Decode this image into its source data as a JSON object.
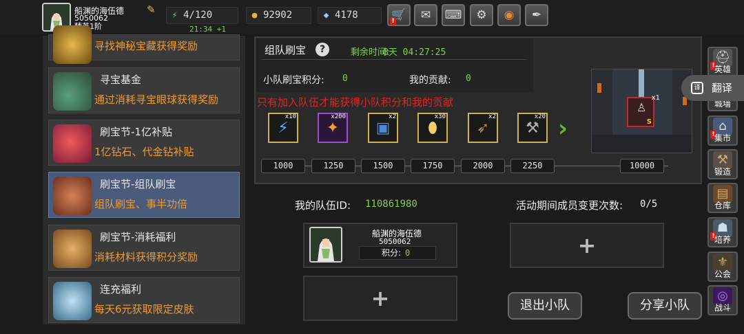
{
  "player": {
    "name": "船渊的海伍德",
    "id": "5050062",
    "rank": "精英1阶"
  },
  "resources": {
    "energy": "4/120",
    "gold": "92902",
    "gems": "4178",
    "timer": "21:34 +1"
  },
  "left_menu": [
    {
      "title": "",
      "desc": "寻找神秘宝藏获得奖励"
    },
    {
      "title": "寻宝基金",
      "desc": "通过消耗寻宝眼球获得奖励"
    },
    {
      "title": "刷宝节-1亿补贴",
      "desc": "1亿钻石、代金钻补贴"
    },
    {
      "title": "刷宝节-组队刷宝",
      "desc": "组队刷宝、事半功倍"
    },
    {
      "title": "刷宝节-消耗福利",
      "desc": "消耗材料获得积分奖励"
    },
    {
      "title": "连充福利",
      "desc": "每天6元获取限定皮肤"
    }
  ],
  "event": {
    "title": "组队刷宝",
    "remaining_label": "剩余时间:",
    "remaining_value": "8天 04:27:25",
    "score_label": "小队刷宝积分:",
    "score_value": "0",
    "contrib_label": "我的贡献:",
    "contrib_value": "0",
    "warning": "只有加入队伍才能获得小队积分和我的贡献"
  },
  "rewards": [
    {
      "count": "x10",
      "icon": "lightning-scroll-icon",
      "glyph": "⚡"
    },
    {
      "count": "x200",
      "icon": "fire-crystal-icon",
      "glyph": "✦"
    },
    {
      "count": "x2",
      "icon": "blue-book-icon",
      "glyph": "▣"
    },
    {
      "count": "x30",
      "icon": "golden-egg-icon",
      "glyph": "⬮"
    },
    {
      "count": "x2",
      "icon": "horn-icon",
      "glyph": "➶"
    },
    {
      "count": "x20",
      "icon": "hammer-icon",
      "glyph": "⚒"
    }
  ],
  "milestones": [
    "1000",
    "1250",
    "1500",
    "1750",
    "2000",
    "2250",
    "10000"
  ],
  "preview": {
    "count": "x1",
    "badge": "S"
  },
  "team": {
    "id_label": "我的队伍ID:",
    "id_value": "110861980",
    "changes_label": "活动期间成员变更次数:",
    "changes_value": "0/5",
    "member_name": "船渊的海伍德",
    "member_id": "5050062",
    "member_score_label": "积分:",
    "member_score_value": "0",
    "leave_button": "退出小队",
    "share_button": "分享小队"
  },
  "right_menu": [
    {
      "label": "英雄",
      "icon": "hero-helmet-icon"
    },
    {
      "label": "城墙",
      "icon": "wall-icon"
    },
    {
      "label": "集市",
      "icon": "market-icon"
    },
    {
      "label": "锻造",
      "icon": "anvil-icon"
    },
    {
      "label": "仓库",
      "icon": "warehouse-icon"
    },
    {
      "label": "培养",
      "icon": "training-icon"
    },
    {
      "label": "公会",
      "icon": "guild-icon"
    },
    {
      "label": "战斗",
      "icon": "battle-portal-icon"
    }
  ],
  "translate_label": "翻译"
}
